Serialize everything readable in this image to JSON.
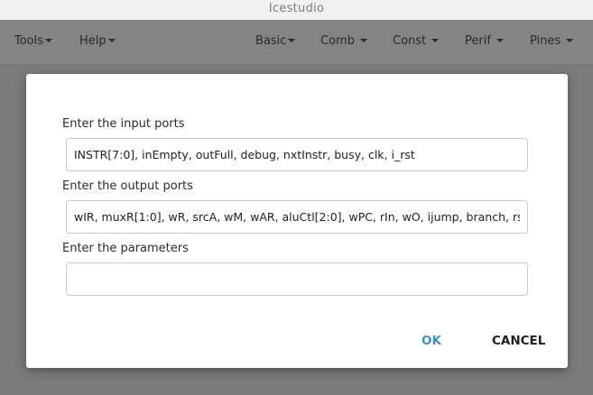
{
  "window": {
    "title": "Icestudio"
  },
  "menubar": {
    "left_items": [
      {
        "label": "Tools"
      },
      {
        "label": "Help"
      }
    ],
    "right_items": [
      {
        "label": "Basic"
      },
      {
        "label": "Comb"
      },
      {
        "label": "Const"
      },
      {
        "label": "Perif"
      },
      {
        "label": "Pines"
      }
    ]
  },
  "dialog": {
    "input_ports_label": "Enter the input ports",
    "input_ports_value": "INSTR[7:0], inEmpty, outFull, debug, nxtInstr, busy, clk, i_rst",
    "output_ports_label": "Enter the output ports",
    "output_ports_value": "wIR, muxR[1:0], wR, srcA, wM, wAR, aluCtl[2:0], wPC, rIn, wO, ijump, branch, rst,",
    "parameters_label": "Enter the parameters",
    "parameters_value": "",
    "ok_label": "OK",
    "cancel_label": "CANCEL"
  },
  "colors": {
    "overlay": "#7b7b7b",
    "titlebar": "#f1f1f1",
    "accent": "#3a8fcf"
  }
}
